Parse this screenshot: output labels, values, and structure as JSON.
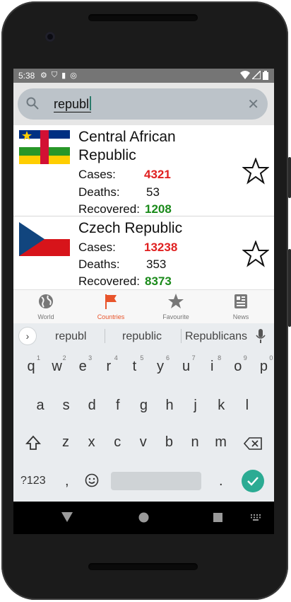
{
  "status_bar": {
    "time": "5:38"
  },
  "search": {
    "query": "republ"
  },
  "results": [
    {
      "country": "Central African Republic",
      "cases_label": "Cases:",
      "cases": "4321",
      "deaths_label": "Deaths:",
      "deaths": "53",
      "recovered_label": "Recovered:",
      "recovered": "1208"
    },
    {
      "country": "Czech Republic",
      "cases_label": "Cases:",
      "cases": "13238",
      "deaths_label": "Deaths:",
      "deaths": "353",
      "recovered_label": "Recovered:",
      "recovered": "8373"
    }
  ],
  "bottom_nav": [
    {
      "label": "World",
      "icon": "globe-icon"
    },
    {
      "label": "Countries",
      "icon": "flag-icon",
      "active": true
    },
    {
      "label": "Favourite",
      "icon": "star-icon"
    },
    {
      "label": "News",
      "icon": "newspaper-icon"
    }
  ],
  "keyboard": {
    "suggestions": [
      "republ",
      "republic",
      "Republicans"
    ],
    "row1": [
      "q",
      "w",
      "e",
      "r",
      "t",
      "y",
      "u",
      "i",
      "o",
      "p"
    ],
    "row1_hints": [
      "1",
      "2",
      "3",
      "4",
      "5",
      "6",
      "7",
      "8",
      "9",
      "0"
    ],
    "row2": [
      "a",
      "s",
      "d",
      "f",
      "g",
      "h",
      "j",
      "k",
      "l"
    ],
    "row3": [
      "z",
      "x",
      "c",
      "v",
      "b",
      "n",
      "m"
    ],
    "symbols_label": "?123",
    "comma": ",",
    "period": "."
  },
  "colors": {
    "accent": "#e8542b",
    "cases": "#e02020",
    "recovered": "#1a8a1a",
    "enter": "#2bab93",
    "search_bg": "#bcc3c9"
  }
}
